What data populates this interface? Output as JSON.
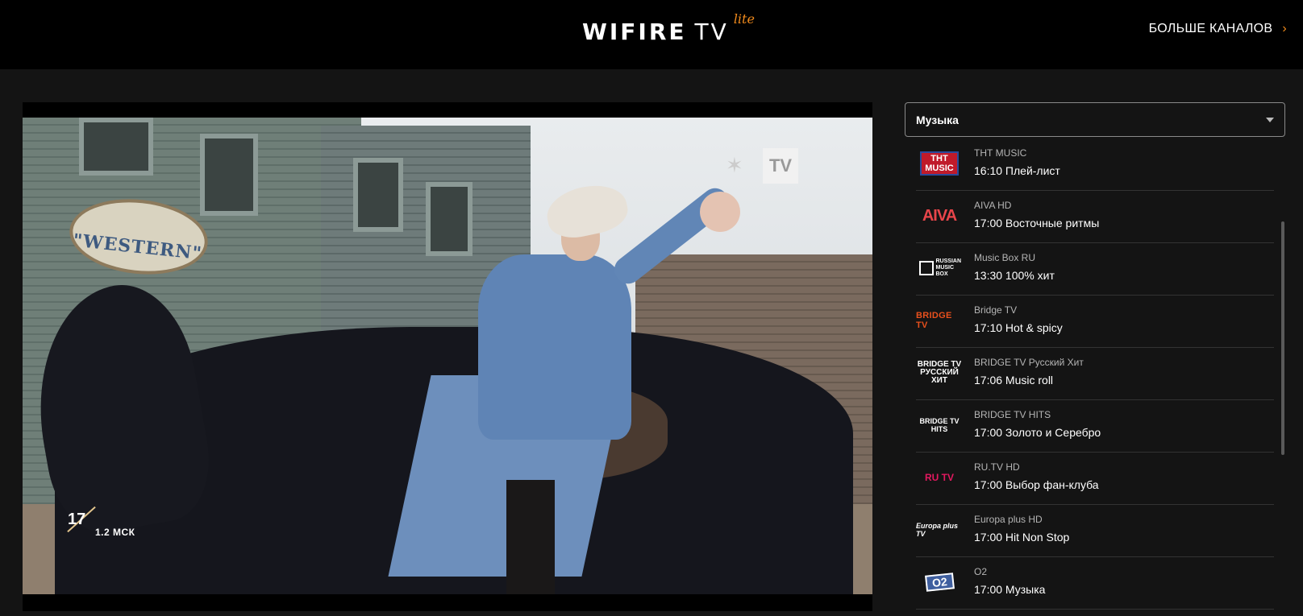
{
  "header": {
    "logo_main": "WIFIRE",
    "logo_tv": "TV",
    "logo_lite": "lite",
    "more_channels": "БОЛЬШЕ КАНАЛОВ",
    "more_channels_arrow": "›"
  },
  "player": {
    "overlay_badge": "TV",
    "age_rating": "17",
    "age_rating_sub": "1.2 МСК",
    "sign_text": "\"WESTERN\""
  },
  "sidebar": {
    "category": "Музыка",
    "channels": [
      {
        "name": "ТНТ MUSIC",
        "program": "16:10 Плей-лист",
        "logo": "ТНТ\nMUSIC"
      },
      {
        "name": "AIVA HD",
        "program": "17:00 Восточные ритмы",
        "logo": "AIVA"
      },
      {
        "name": "Music Box RU",
        "program": "13:30 100% хит",
        "logo": "RUSSIAN MUSIC BOX"
      },
      {
        "name": "Bridge TV",
        "program": "17:10 Hot & spicy",
        "logo": "BRIDGE TV"
      },
      {
        "name": "BRIDGE TV Русский Хит",
        "program": "17:06 Music roll",
        "logo": "BRIDGE TV РУССКИЙ ХИТ"
      },
      {
        "name": "BRIDGE TV HITS",
        "program": "17:00 Золото и Серебро",
        "logo": "BRIDGE TV HITS"
      },
      {
        "name": "RU.TV HD",
        "program": "17:00 Выбор фан-клуба",
        "logo": "RU TV"
      },
      {
        "name": "Europa plus HD",
        "program": "17:00 Hit Non Stop",
        "logo": "Europa plus TV"
      },
      {
        "name": "O2",
        "program": "17:00 Музыка",
        "logo": "O2"
      }
    ]
  },
  "colors": {
    "accent": "#f08a1c",
    "background": "#141414",
    "header": "#000000"
  }
}
